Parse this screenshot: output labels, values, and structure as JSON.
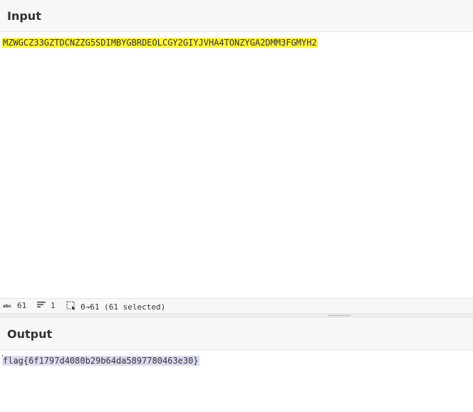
{
  "input": {
    "title": "Input",
    "text": "MZWGCZ33GZTDCNZZG5SDIMBYGBRDEOLCGY2GIYJVHA4TONZYGA2DMM3FGMYH2"
  },
  "status": {
    "length_label": "61",
    "lines_label": "1",
    "selection_label": "0→61 (61 selected)",
    "icons": [
      "abc-length-icon",
      "lines-icon",
      "selection-icon"
    ]
  },
  "output": {
    "title": "Output",
    "text": "flag{6f1797d4080b29b64da5897780463e30}"
  },
  "colors": {
    "input_highlight": "#fff33a",
    "output_highlight": "#dcdcf0"
  }
}
